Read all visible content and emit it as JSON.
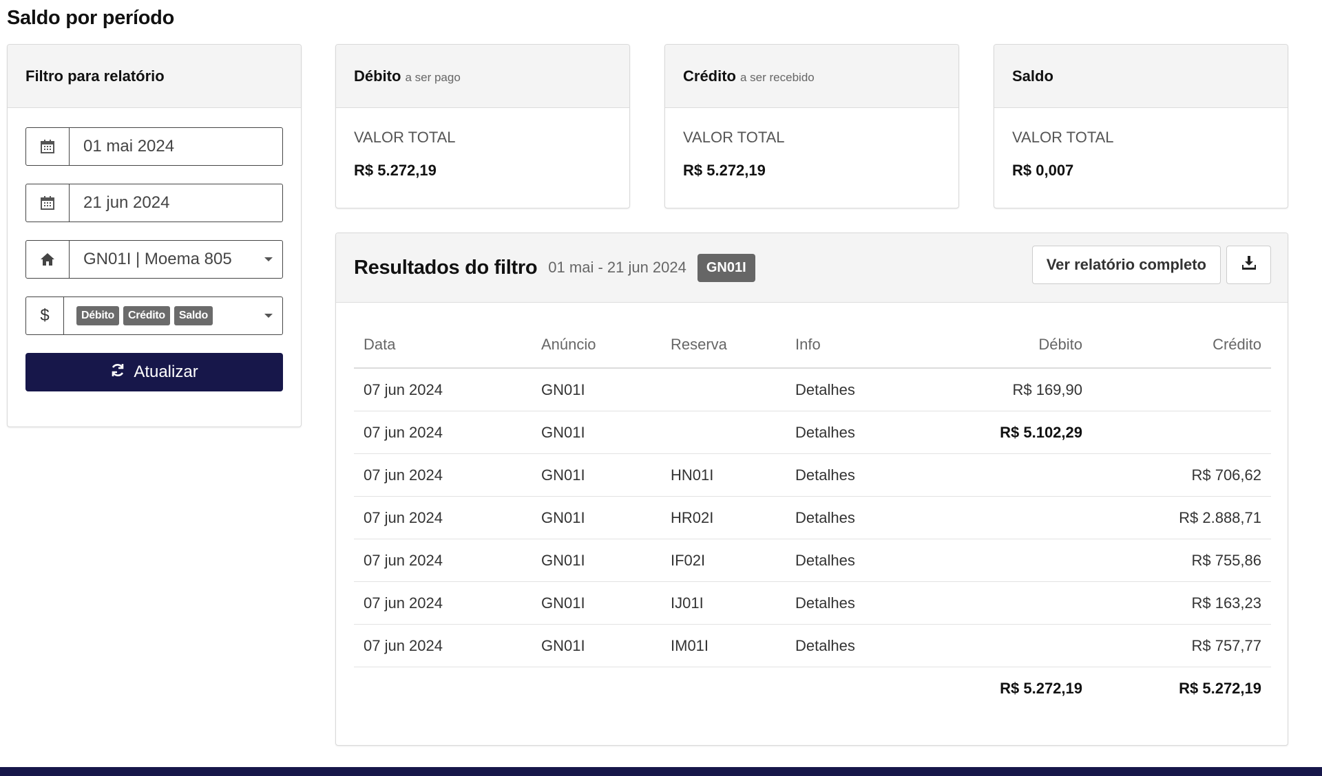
{
  "page": {
    "title": "Saldo por período"
  },
  "filter": {
    "header": "Filtro para relatório",
    "date_start": "01 mai 2024",
    "date_end": "21 jun 2024",
    "property": "GN01I | Moema 805",
    "currency_symbol": "$",
    "types": [
      "Débito",
      "Crédito",
      "Saldo"
    ],
    "refresh_label": "Atualizar"
  },
  "summary": {
    "debit": {
      "title": "Débito",
      "subtitle": "a ser pago",
      "label": "VALOR TOTAL",
      "value": "R$ 5.272,19"
    },
    "credit": {
      "title": "Crédito",
      "subtitle": "a ser recebido",
      "label": "VALOR TOTAL",
      "value": "R$ 5.272,19"
    },
    "balance": {
      "title": "Saldo",
      "label": "VALOR TOTAL",
      "value": "R$ 0,007"
    }
  },
  "results": {
    "title": "Resultados do filtro",
    "range": "01 mai - 21 jun 2024",
    "badge": "GN01I",
    "report_button": "Ver relatório completo",
    "columns": [
      "Data",
      "Anúncio",
      "Reserva",
      "Info",
      "Débito",
      "Crédito"
    ],
    "rows": [
      {
        "data": "07 jun 2024",
        "anuncio": "GN01I",
        "reserva": "",
        "info": "Detalhes",
        "debito": "R$ 169,90",
        "credito": ""
      },
      {
        "data": "07 jun 2024",
        "anuncio": "GN01I",
        "reserva": "",
        "info": "Detalhes",
        "debito": "R$ 5.102,29",
        "credito": ""
      },
      {
        "data": "07 jun 2024",
        "anuncio": "GN01I",
        "reserva": "HN01I",
        "info": "Detalhes",
        "debito": "",
        "credito": "R$ 706,62"
      },
      {
        "data": "07 jun 2024",
        "anuncio": "GN01I",
        "reserva": "HR02I",
        "info": "Detalhes",
        "debito": "",
        "credito": "R$ 2.888,71"
      },
      {
        "data": "07 jun 2024",
        "anuncio": "GN01I",
        "reserva": "IF02I",
        "info": "Detalhes",
        "debito": "",
        "credito": "R$ 755,86"
      },
      {
        "data": "07 jun 2024",
        "anuncio": "GN01I",
        "reserva": "IJ01I",
        "info": "Detalhes",
        "debito": "",
        "credito": "R$ 163,23"
      },
      {
        "data": "07 jun 2024",
        "anuncio": "GN01I",
        "reserva": "IM01I",
        "info": "Detalhes",
        "debito": "",
        "credito": "R$ 757,77"
      }
    ],
    "totals": {
      "debito": "R$ 5.272,19",
      "credito": "R$ 5.272,19"
    }
  },
  "icons": {
    "date_start": "calendar-icon",
    "date_end": "calendar-icon",
    "property": "home-icon",
    "refresh": "refresh-icon",
    "download": "download-icon"
  },
  "colors": {
    "primary": "#17174a",
    "badge": "#666666",
    "tag": "#6b6b6b"
  }
}
